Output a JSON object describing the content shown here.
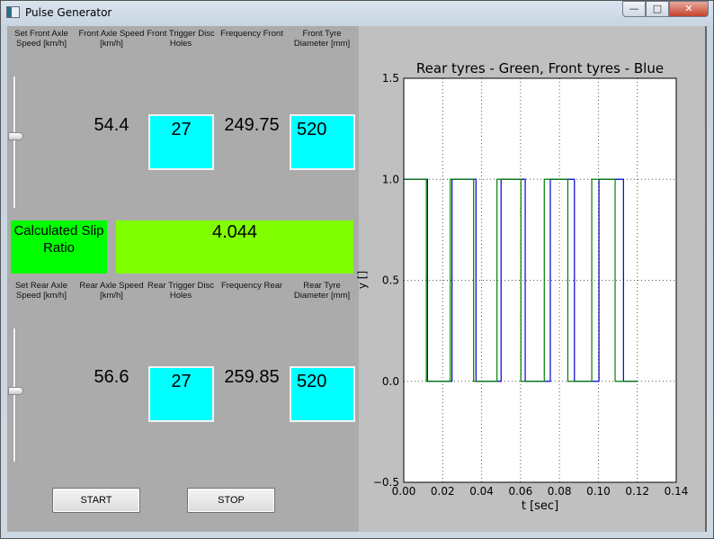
{
  "window": {
    "title": "Pulse Generator",
    "buttons": {
      "minimize": "—",
      "maximize": "□",
      "close": "✕"
    }
  },
  "front": {
    "headers": [
      "Set Front Axle Speed [km/h]",
      "Front Axle Speed [km/h]",
      "Front Trigger Disc Holes",
      "Frequency Front",
      "Front Tyre Diameter [mm]"
    ],
    "axle_speed": "54.4",
    "disc_holes": "27",
    "frequency": "249.75",
    "tyre_diameter": "520",
    "slider_level": 0.45
  },
  "slip": {
    "label": "Calculated Slip Ratio",
    "value": "4.044"
  },
  "rear": {
    "headers": [
      "Set Rear Axle Speed [km/h]",
      "Rear Axle Speed [km/h]",
      "Rear Trigger Disc Holes",
      "Frequency Rear",
      "Rear Tyre Diameter [mm]"
    ],
    "axle_speed": "56.6",
    "disc_holes": "27",
    "frequency": "259.85",
    "tyre_diameter": "520",
    "slider_level": 0.53
  },
  "buttons": {
    "start": "START",
    "stop": "STOP"
  },
  "colors": {
    "cyan_box": "#00ffff",
    "slip_label": "#00ff00",
    "slip_value": "#80ff00",
    "front_series": "#0000cc",
    "rear_series": "#008000"
  },
  "chart_data": {
    "type": "line",
    "title": "Rear tyres - Green, Front tyres - Blue",
    "xlabel": "t [sec]",
    "ylabel": "y []",
    "xlim": [
      0,
      0.14
    ],
    "ylim": [
      -0.5,
      1.5
    ],
    "xticks": [
      "0.00",
      "0.02",
      "0.04",
      "0.06",
      "0.08",
      "0.10",
      "0.12",
      "0.14"
    ],
    "yticks": [
      "−0.5",
      "0.0",
      "0.5",
      "1.0",
      "1.5"
    ],
    "grid": true,
    "series": [
      {
        "color": "#0000cc",
        "start": 1,
        "end": 0.12,
        "edges": [
          0.0122,
          0.0248,
          0.0371,
          0.05,
          0.0624,
          0.0753,
          0.0877,
          0.1003,
          0.1129
        ]
      },
      {
        "color": "#008000",
        "start": 1,
        "end": 0.12,
        "edges": [
          0.0116,
          0.0239,
          0.0359,
          0.0479,
          0.0602,
          0.0722,
          0.0843,
          0.0966,
          0.1086
        ]
      }
    ]
  }
}
